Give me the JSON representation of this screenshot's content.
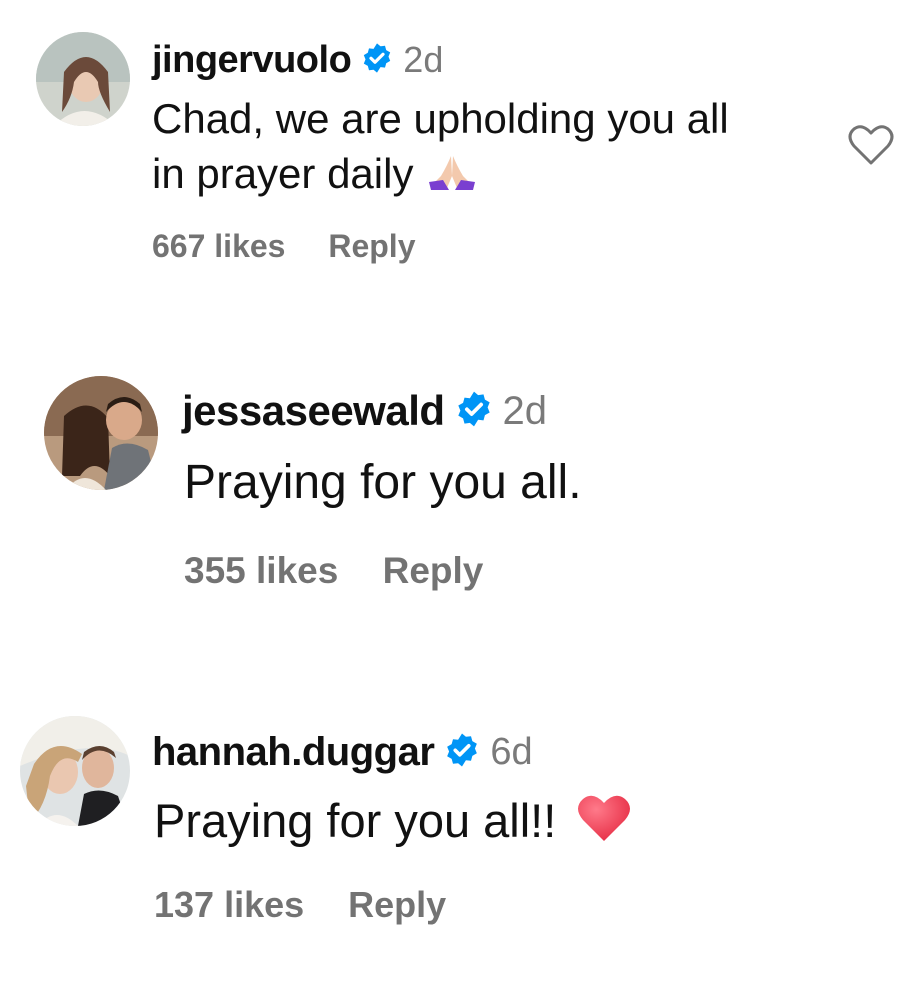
{
  "comments": [
    {
      "username": "jingervuolo",
      "time": "2d",
      "text_line1": "Chad, we are upholding you all",
      "text_line2": "in prayer daily",
      "emoji": "praying-hands",
      "likes": "667 likes",
      "reply": "Reply"
    },
    {
      "username": "jessaseewald",
      "time": "2d",
      "text_line1": "Praying for you all.",
      "likes": "355 likes",
      "reply": "Reply"
    },
    {
      "username": "hannah.duggar",
      "time": "6d",
      "text_line1": "Praying for you all!!",
      "emoji": "red-heart",
      "likes": "137 likes",
      "reply": "Reply"
    }
  ],
  "colors": {
    "verified": "#0095f6",
    "meta": "#737373",
    "heart_emoji": "#e8334a"
  }
}
